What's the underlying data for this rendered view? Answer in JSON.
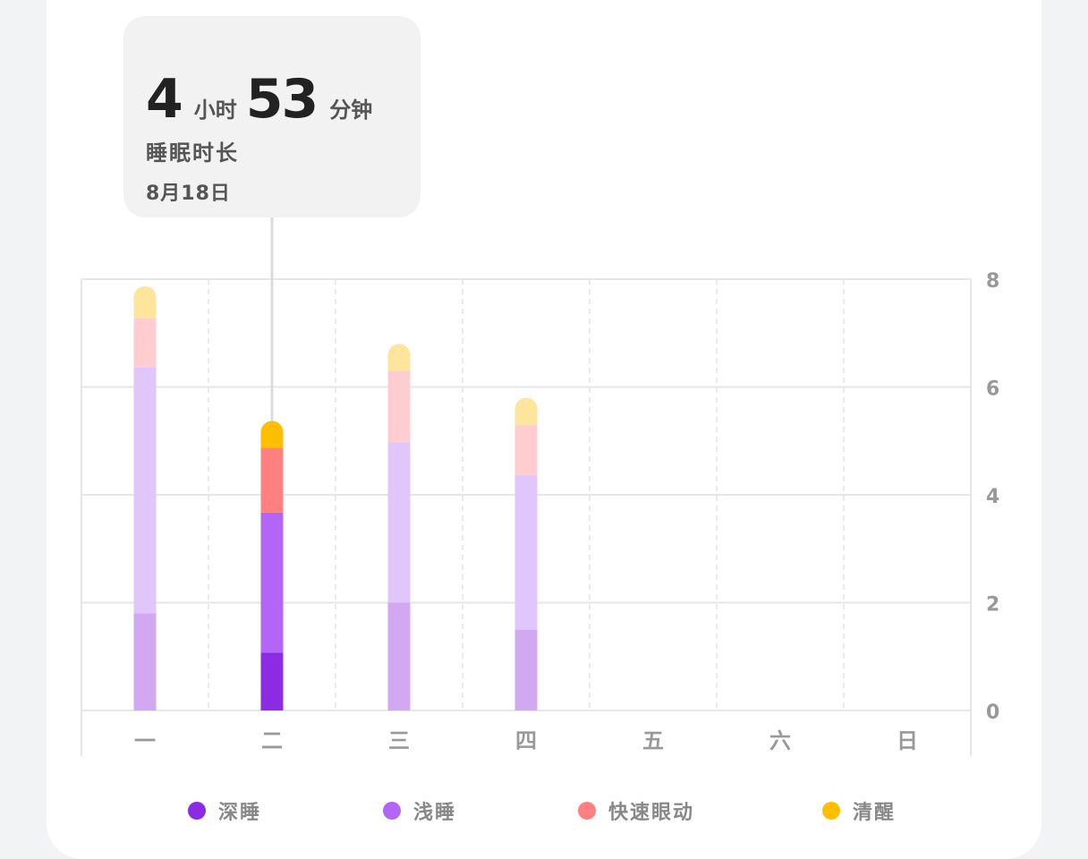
{
  "tooltip": {
    "hours": "4",
    "hours_unit": "小时",
    "minutes": "53",
    "minutes_unit": "分钟",
    "label": "睡眠时长",
    "date": "8月18日"
  },
  "colors": {
    "deep": "#8b2be2",
    "light": "#b366f5",
    "rem": "#ff8080",
    "awake": "#ffbf00",
    "deep_faded": "#d2a9f1",
    "light_faded": "#e1c6fc",
    "rem_faded": "#ffcccf",
    "awake_faded": "#fee59c",
    "grid": "#e6e6e6",
    "axis_text": "#999999"
  },
  "chart_data": {
    "type": "bar",
    "stacked": true,
    "categories": [
      "一",
      "二",
      "三",
      "四",
      "五",
      "六",
      "日"
    ],
    "series": [
      {
        "name": "深睡",
        "values": [
          1.8,
          1.07,
          2.0,
          1.5,
          0,
          0,
          0
        ]
      },
      {
        "name": "浅睡",
        "values": [
          4.57,
          2.6,
          2.97,
          2.87,
          0,
          0,
          0
        ]
      },
      {
        "name": "快速眼动",
        "values": [
          0.9,
          1.2,
          1.33,
          0.93,
          0,
          0,
          0
        ]
      },
      {
        "name": "清醒",
        "values": [
          0.6,
          0.5,
          0.5,
          0.5,
          0,
          0,
          0
        ]
      }
    ],
    "yticks": [
      0,
      2,
      4,
      6,
      8
    ],
    "ylim": [
      0,
      8
    ],
    "highlight_index": 1,
    "legend_position": "bottom",
    "grid": true
  }
}
